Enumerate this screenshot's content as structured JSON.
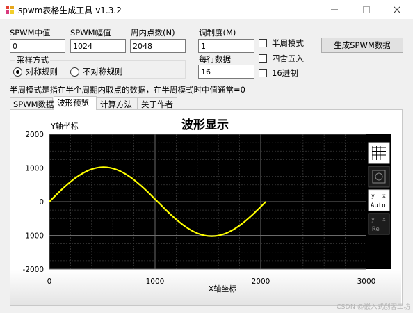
{
  "window": {
    "title": "spwm表格生成工具 v1.3.2",
    "minimize_icon": "minimize-icon",
    "maximize_icon": "maximize-icon",
    "close_icon": "close-icon"
  },
  "form": {
    "center_label": "SPWM中值",
    "center_value": "0",
    "amplitude_label": "SPWM幅值",
    "amplitude_value": "1024",
    "points_label": "周内点数(N)",
    "points_value": "2048",
    "modulation_label": "调制度(M)",
    "modulation_value": "1",
    "per_row_label": "每行数据",
    "per_row_value": "16"
  },
  "options": {
    "half_cycle": "半周模式",
    "rounding": "四舍五入",
    "hex": "16进制"
  },
  "sampling": {
    "title": "采样方式",
    "symmetric": "对称规则",
    "asymmetric": "不对称规则"
  },
  "generate_button": "生成SPWM数据",
  "hint": "半周模式是指在半个周期内取点的数据，在半周模式时中值通常=0",
  "tabs": [
    "SPWM数据",
    "波形预览",
    "计算方法",
    "关于作者"
  ],
  "watermark": "CSDN @嵌入式创客工坊",
  "chart_data": {
    "type": "line",
    "title": "波形显示",
    "xlabel": "X轴坐标",
    "ylabel": "Y轴坐标",
    "xlim": [
      0,
      3000
    ],
    "ylim": [
      -2000,
      2000
    ],
    "x_ticks": [
      "0",
      "1000",
      "2000",
      "3000"
    ],
    "y_ticks": [
      "2000",
      "1000",
      "0",
      "-1000",
      "-2000"
    ],
    "grid": true,
    "background": "#000000",
    "line_color": "#ffff00",
    "series": [
      {
        "x": [
          0,
          128,
          256,
          384,
          512,
          640,
          768,
          896,
          1024,
          1152,
          1280,
          1408,
          1536,
          1664,
          1792,
          1920,
          2048
        ],
        "values": [
          0,
          392,
          724,
          946,
          1024,
          946,
          724,
          392,
          0,
          -392,
          -724,
          -946,
          -1024,
          -946,
          -724,
          -392,
          0
        ]
      }
    ],
    "toolbar_icons": [
      "grid-icon",
      "zoom-fit-icon",
      "auto-scale-icon",
      "reset-icon"
    ],
    "toolbar_labels": [
      "",
      "",
      "Auto",
      "Re"
    ]
  }
}
